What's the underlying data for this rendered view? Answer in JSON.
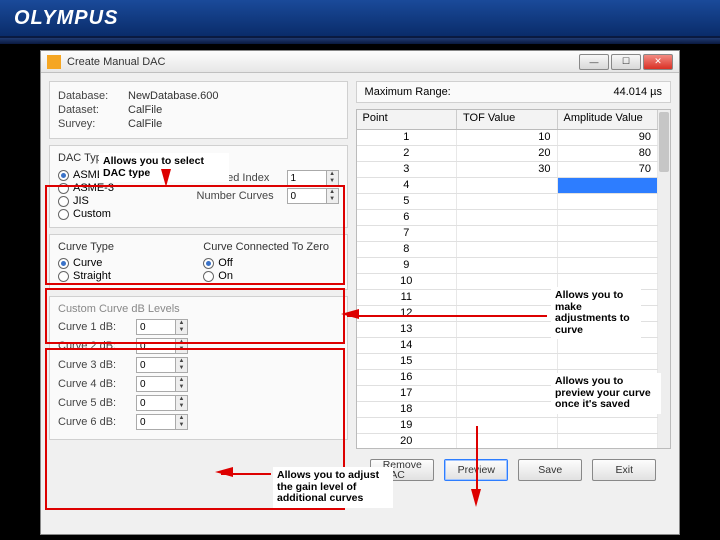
{
  "banner": {
    "brand": "OLYMPUS"
  },
  "window": {
    "title": "Create Manual DAC",
    "buttons": {
      "min": "—",
      "max": "☐",
      "close": "✕"
    }
  },
  "info": {
    "database_label": "Database:",
    "database": "NewDatabase.600",
    "dataset_label": "Dataset:",
    "dataset": "CalFile",
    "survey_label": "Survey:",
    "survey": "CalFile"
  },
  "dactype": {
    "title": "DAC Type",
    "options": [
      "ASME",
      "ASME-3",
      "JIS",
      "Custom"
    ],
    "selected": "ASME",
    "selindex_label": "Selected Index",
    "selindex": "1",
    "numcurves_label": "Number Curves",
    "numcurves": "0"
  },
  "curve": {
    "type_label": "Curve Type",
    "type_opts": [
      "Curve",
      "Straight"
    ],
    "type_sel": "Curve",
    "zero_label": "Curve Connected To Zero",
    "zero_opts": [
      "Off",
      "On"
    ],
    "zero_sel": "Off"
  },
  "dblevels": {
    "title": "Custom Curve dB Levels",
    "rows": [
      {
        "label": "Curve 1 dB:",
        "val": "0"
      },
      {
        "label": "Curve 2 dB:",
        "val": "0"
      },
      {
        "label": "Curve 3 dB:",
        "val": "0"
      },
      {
        "label": "Curve 4 dB:",
        "val": "0"
      },
      {
        "label": "Curve 5 dB:",
        "val": "0"
      },
      {
        "label": "Curve 6 dB:",
        "val": "0"
      }
    ]
  },
  "right": {
    "maxrange_label": "Maximum Range:",
    "maxrange_val": "44.014 µs",
    "headers": [
      "Point",
      "TOF Value",
      "Amplitude Value"
    ],
    "rows": [
      {
        "p": "1",
        "t": "10",
        "a": "90"
      },
      {
        "p": "2",
        "t": "20",
        "a": "80"
      },
      {
        "p": "3",
        "t": "30",
        "a": "70"
      },
      {
        "p": "4",
        "t": "",
        "a": ""
      },
      {
        "p": "5",
        "t": "",
        "a": ""
      },
      {
        "p": "6",
        "t": "",
        "a": ""
      },
      {
        "p": "7",
        "t": "",
        "a": ""
      },
      {
        "p": "8",
        "t": "",
        "a": ""
      },
      {
        "p": "9",
        "t": "",
        "a": ""
      },
      {
        "p": "10",
        "t": "",
        "a": ""
      },
      {
        "p": "11",
        "t": "",
        "a": ""
      },
      {
        "p": "12",
        "t": "",
        "a": ""
      },
      {
        "p": "13",
        "t": "",
        "a": ""
      },
      {
        "p": "14",
        "t": "",
        "a": ""
      },
      {
        "p": "15",
        "t": "",
        "a": ""
      },
      {
        "p": "16",
        "t": "",
        "a": ""
      },
      {
        "p": "17",
        "t": "",
        "a": ""
      },
      {
        "p": "18",
        "t": "",
        "a": ""
      },
      {
        "p": "19",
        "t": "",
        "a": ""
      },
      {
        "p": "20",
        "t": "",
        "a": ""
      }
    ]
  },
  "buttons": {
    "remove": "Remove\nDAC",
    "preview": "Preview",
    "save": "Save",
    "exit": "Exit"
  },
  "annotations": {
    "a1": "Allows you to select DAC type",
    "a2": "Allows you to make adjustments to curve",
    "a3": "Allows you to preview your curve once it's saved",
    "a4": "Allows you to adjust the gain level of additional curves"
  }
}
